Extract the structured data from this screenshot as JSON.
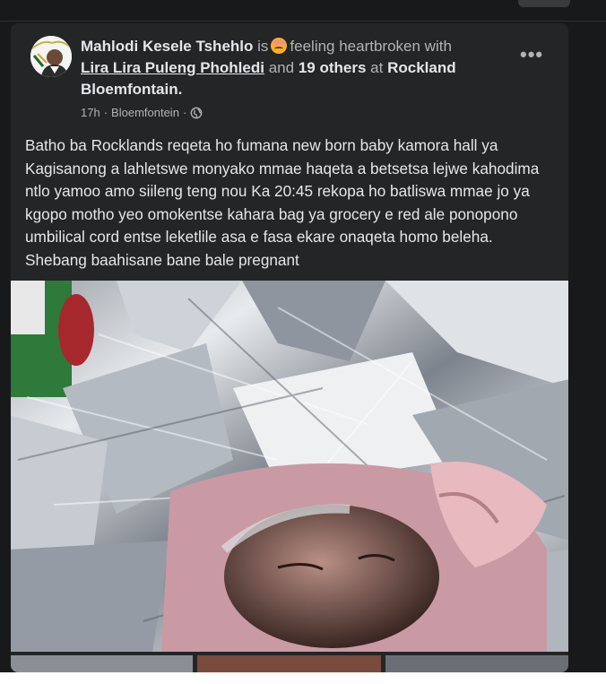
{
  "post": {
    "author": "Mahlodi Kesele Tshehlo",
    "is_text": "is",
    "feeling_text": "feeling heartbroken with",
    "tagged_friend": "Lira Lira Puleng Phohledi",
    "and_text": "and",
    "others": "19 others",
    "at_text": "at",
    "location_line1": "Rockland",
    "location_line2": "Bloemfontain.",
    "time": "17h",
    "separator": "·",
    "place": "Bloemfontein",
    "separator2": "·",
    "privacy_icon": "globe-icon",
    "more_label": "•••",
    "text": "Batho ba Rocklands reqeta ho fumana new born baby kamora hall ya Kagisanong a lahletswe monyako mmae haqeta a betsetsa lejwe kahodima ntlo yamoo amo siileng teng nou Ka 20:45 rekopa ho batliswa mmae jo ya kgopo motho yeo omokentse kahara bag ya grocery e red ale ponopono umbilical cord entse leketlile asa e fasa ekare onaqeta homo beleha. Shebang baahisane bane bale pregnant"
  },
  "colors": {
    "page_bg": "#18191a",
    "card_bg": "#242526",
    "primary_text": "#e4e6eb",
    "secondary_text": "#b0b3b8"
  }
}
